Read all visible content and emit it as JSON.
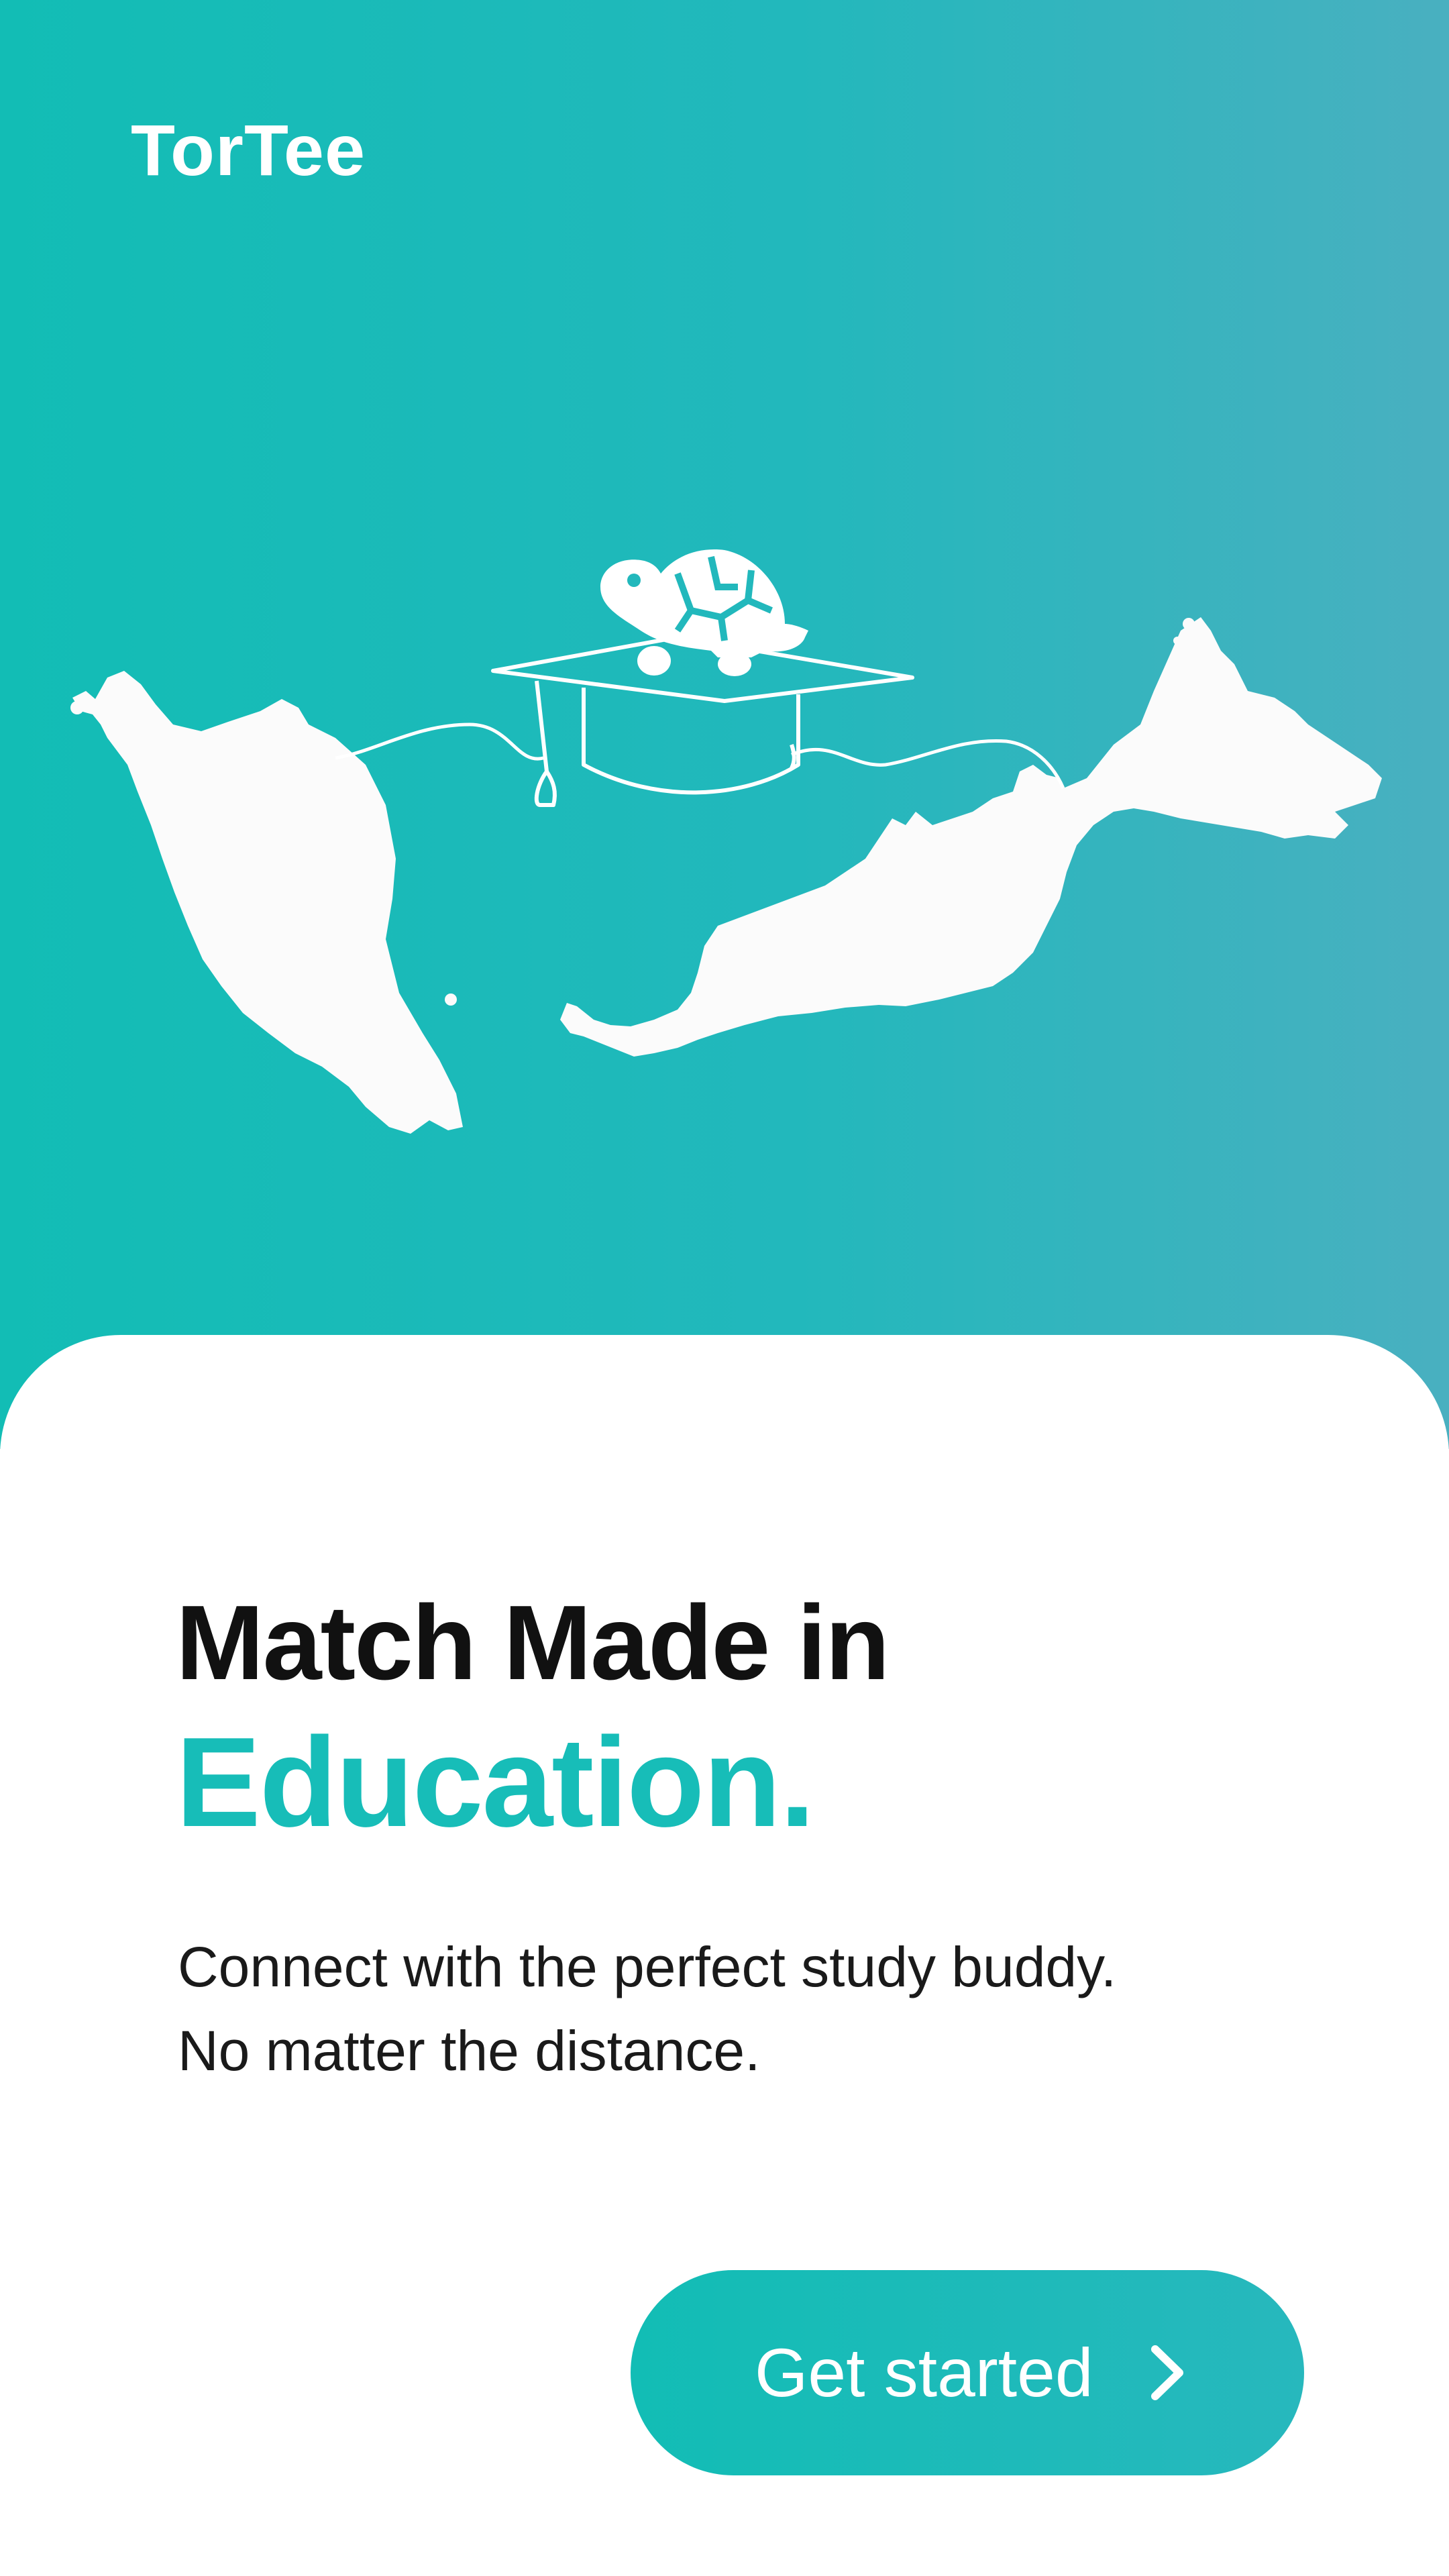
{
  "brand": {
    "name": "TorTee"
  },
  "hero": {
    "illustration": "turtle-graduation-cap-over-malaysia-map",
    "background_start": "#12bdb5",
    "background_end": "#49b0c0"
  },
  "content": {
    "headline_line1": "Match Made in",
    "headline_line2": "Education.",
    "subtext_line1": "Connect with the perfect study buddy.",
    "subtext_line2": "No matter the distance."
  },
  "cta": {
    "label": "Get started",
    "icon": "chevron-right-icon"
  },
  "colors": {
    "accent": "#17bdb8",
    "headline": "#111111",
    "body_text": "#1a1a1a",
    "card": "#ffffff"
  }
}
